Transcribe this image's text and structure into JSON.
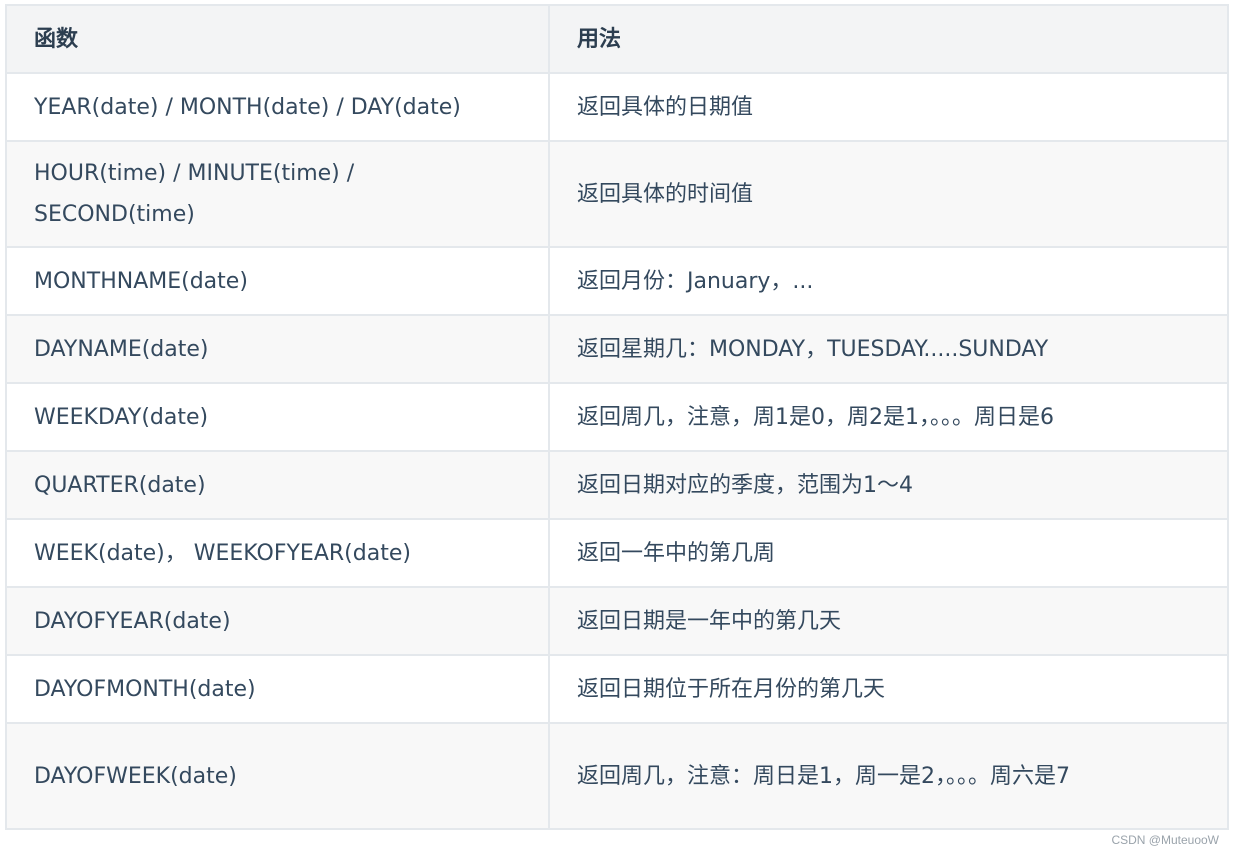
{
  "table": {
    "headers": [
      "函数",
      "用法"
    ],
    "rows": [
      {
        "func": "YEAR(date) / MONTH(date) / DAY(date)",
        "usage": "返回具体的日期值"
      },
      {
        "func": "HOUR(time) / MINUTE(time) / SECOND(time)",
        "usage": "返回具体的时间值"
      },
      {
        "func": "MONTHNAME(date)",
        "usage": "返回月份：January，..."
      },
      {
        "func": "DAYNAME(date)",
        "usage": "返回星期几：MONDAY，TUESDAY.....SUNDAY"
      },
      {
        "func": "WEEKDAY(date)",
        "usage": "返回周几，注意，周1是0，周2是1，。。。周日是6"
      },
      {
        "func": "QUARTER(date)",
        "usage": "返回日期对应的季度，范围为1～4"
      },
      {
        "func": "WEEK(date)， WEEKOFYEAR(date)",
        "usage": "返回一年中的第几周"
      },
      {
        "func": "DAYOFYEAR(date)",
        "usage": "返回日期是一年中的第几天"
      },
      {
        "func": "DAYOFMONTH(date)",
        "usage": "返回日期位于所在月份的第几天"
      },
      {
        "func": "DAYOFWEEK(date)",
        "usage": "返回周几，注意：周日是1，周一是2，。。。周六是7"
      }
    ]
  },
  "watermark": "CSDN @MuteuooW"
}
